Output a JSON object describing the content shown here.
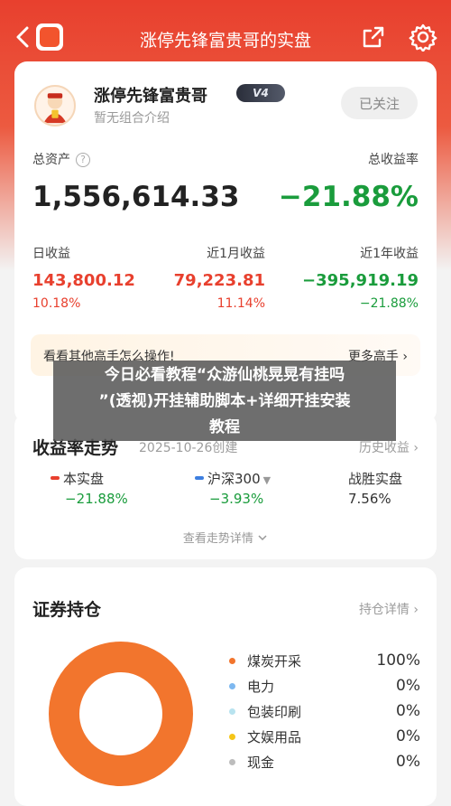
{
  "topbar": {
    "title": "涨停先锋富贵哥的实盘"
  },
  "profile": {
    "name": "涨停先锋富贵哥",
    "level": "V4",
    "intro": "暂无组合介绍",
    "follow_label": "已关注"
  },
  "summary": {
    "total_assets_label": "总资产",
    "help_glyph": "?",
    "total_assets": "1,556,614.33",
    "total_return_label": "总收益率",
    "total_return": "−21.88%"
  },
  "returns": [
    {
      "label": "日收益",
      "value": "143,800.12",
      "pct": "10.18%",
      "tone": "red"
    },
    {
      "label": "近1月收益",
      "value": "79,223.81",
      "pct": "11.14%",
      "tone": "red"
    },
    {
      "label": "近1年收益",
      "value": "−395,919.19",
      "pct": "−21.88%",
      "tone": "green"
    }
  ],
  "promo": {
    "text": "看看其他高手怎么操作!",
    "more": "更多高手 ›"
  },
  "overlay": {
    "lines": [
      "今日必看教程“众游仙桃晃晃有挂吗",
      "”(透视)开挂辅助脚本+详细开挂安装",
      "教程"
    ]
  },
  "trend": {
    "title": "收益率走势",
    "date": "2025-10-26创建",
    "history_link": "历史收益 ›",
    "series": [
      {
        "name": "本实盘",
        "value": "−21.88%",
        "color": "#e8402e"
      },
      {
        "name": "沪深300",
        "value": "−3.93%",
        "color": "#3d7fe0"
      },
      {
        "name": "战胜实盘",
        "value": "7.56%"
      }
    ],
    "detail_link": "查看走势详情"
  },
  "holdings": {
    "title": "证券持仓",
    "detail_link": "持仓详情 ›",
    "items": [
      {
        "name": "煤炭开采",
        "pct": "100%",
        "value": 100,
        "color": "#f2752d"
      },
      {
        "name": "电力",
        "pct": "0%",
        "value": 0,
        "color": "#7db8f0"
      },
      {
        "name": "包装印刷",
        "pct": "0%",
        "value": 0,
        "color": "#b8e3ef"
      },
      {
        "name": "文娱用品",
        "pct": "0%",
        "value": 0,
        "color": "#f5c518"
      },
      {
        "name": "现金",
        "pct": "0%",
        "value": 0,
        "color": "#bdbdbd"
      }
    ]
  }
}
